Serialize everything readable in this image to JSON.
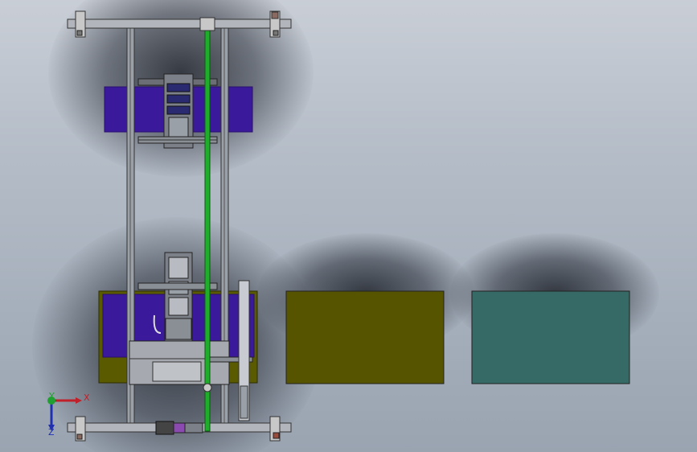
{
  "scene": {
    "background_top": "#c9ced6",
    "background_bottom": "#9aa4b1",
    "plate_olive_color": "#575400",
    "plate_teal_color": "#356a67",
    "plate_purple_color": "#3a1a9a",
    "rail_green_color": "#1fae2a"
  },
  "triad": {
    "x_label": "X",
    "y_label": "Y",
    "z_label": "Z",
    "x_color": "#c0202a",
    "y_color": "#20a030",
    "z_color": "#2030b0"
  },
  "icons": {
    "triad": "coordinate-triad-icon"
  }
}
